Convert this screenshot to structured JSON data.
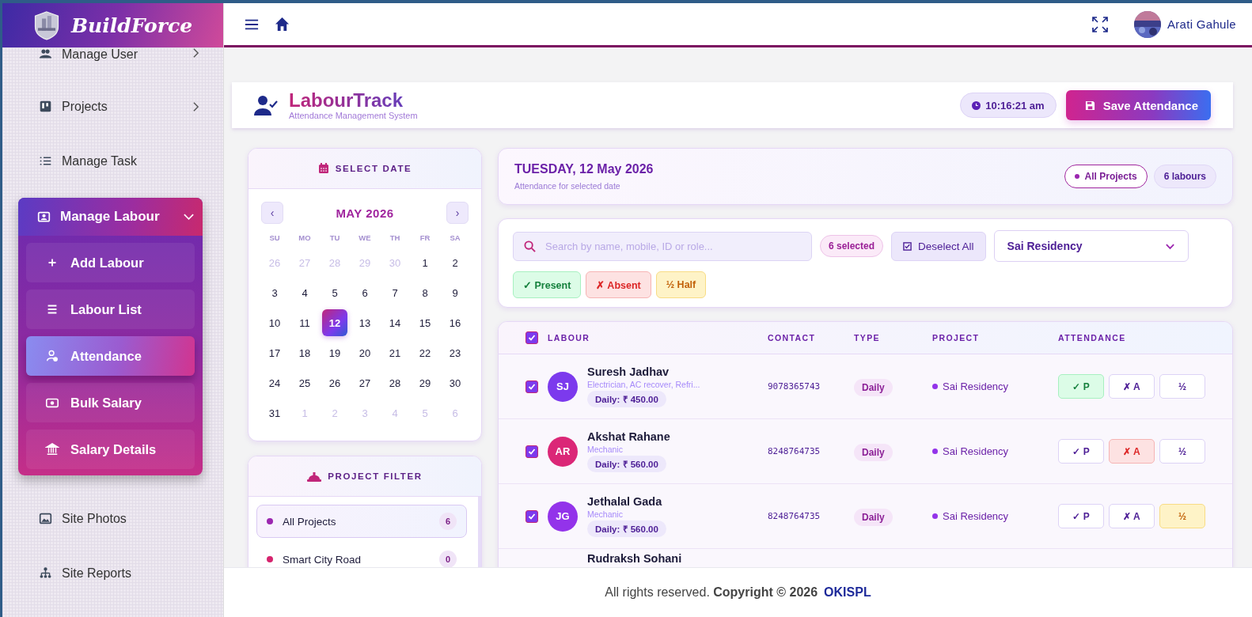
{
  "brand": "BuildForce",
  "sidebar": {
    "items": [
      {
        "label": "Manage User",
        "expanded": false
      },
      {
        "label": "Projects",
        "expanded": false
      },
      {
        "label": "Manage Task"
      },
      {
        "label": "Manage Labour",
        "expanded": true,
        "children": [
          {
            "label": "Add Labour",
            "selected": false
          },
          {
            "label": "Labour List",
            "selected": false
          },
          {
            "label": "Attendance",
            "selected": true
          },
          {
            "label": "Bulk Salary",
            "selected": false
          },
          {
            "label": "Salary Details",
            "selected": false
          }
        ]
      },
      {
        "label": "Site Photos"
      },
      {
        "label": "Site Reports"
      }
    ]
  },
  "topbar": {
    "user": "Arati Gahule"
  },
  "header": {
    "title": "LabourTrack",
    "subtitle": "Attendance Management System",
    "time": "10:16:21 am",
    "save_button": "Save Attendance"
  },
  "calendar": {
    "heading": "SELECT DATE",
    "prev": "‹",
    "next": "›",
    "month": "MAY 2026",
    "weekdays": [
      "SU",
      "MO",
      "TU",
      "WE",
      "TH",
      "FR",
      "SA"
    ],
    "days": [
      {
        "label": "26",
        "muted": true,
        "selected": false
      },
      {
        "label": "27",
        "muted": true,
        "selected": false
      },
      {
        "label": "28",
        "muted": true,
        "selected": false
      },
      {
        "label": "29",
        "muted": true,
        "selected": false
      },
      {
        "label": "30",
        "muted": true,
        "selected": false
      },
      {
        "label": "1",
        "muted": false,
        "selected": false
      },
      {
        "label": "2",
        "muted": false,
        "selected": false
      },
      {
        "label": "3",
        "muted": false,
        "selected": false
      },
      {
        "label": "4",
        "muted": false,
        "selected": false
      },
      {
        "label": "5",
        "muted": false,
        "selected": false
      },
      {
        "label": "6",
        "muted": false,
        "selected": false
      },
      {
        "label": "7",
        "muted": false,
        "selected": false
      },
      {
        "label": "8",
        "muted": false,
        "selected": false
      },
      {
        "label": "9",
        "muted": false,
        "selected": false
      },
      {
        "label": "10",
        "muted": false,
        "selected": false
      },
      {
        "label": "11",
        "muted": false,
        "selected": false
      },
      {
        "label": "12",
        "muted": false,
        "selected": true
      },
      {
        "label": "13",
        "muted": false,
        "selected": false
      },
      {
        "label": "14",
        "muted": false,
        "selected": false
      },
      {
        "label": "15",
        "muted": false,
        "selected": false
      },
      {
        "label": "16",
        "muted": false,
        "selected": false
      },
      {
        "label": "17",
        "muted": false,
        "selected": false
      },
      {
        "label": "18",
        "muted": false,
        "selected": false
      },
      {
        "label": "19",
        "muted": false,
        "selected": false
      },
      {
        "label": "20",
        "muted": false,
        "selected": false
      },
      {
        "label": "21",
        "muted": false,
        "selected": false
      },
      {
        "label": "22",
        "muted": false,
        "selected": false
      },
      {
        "label": "23",
        "muted": false,
        "selected": false
      },
      {
        "label": "24",
        "muted": false,
        "selected": false
      },
      {
        "label": "25",
        "muted": false,
        "selected": false
      },
      {
        "label": "26",
        "muted": false,
        "selected": false
      },
      {
        "label": "27",
        "muted": false,
        "selected": false
      },
      {
        "label": "28",
        "muted": false,
        "selected": false
      },
      {
        "label": "29",
        "muted": false,
        "selected": false
      },
      {
        "label": "30",
        "muted": false,
        "selected": false
      },
      {
        "label": "31",
        "muted": false,
        "selected": false
      },
      {
        "label": "1",
        "muted": true,
        "selected": false
      },
      {
        "label": "2",
        "muted": true,
        "selected": false
      },
      {
        "label": "3",
        "muted": true,
        "selected": false
      },
      {
        "label": "4",
        "muted": true,
        "selected": false
      },
      {
        "label": "5",
        "muted": true,
        "selected": false
      },
      {
        "label": "6",
        "muted": true,
        "selected": false
      }
    ]
  },
  "project_filter": {
    "heading": "PROJECT FILTER",
    "items": [
      {
        "label": "All Projects",
        "count": "6",
        "color": "#9c27b0",
        "selected": true
      },
      {
        "label": "Smart City Road",
        "count": "0",
        "color": "#d6246e",
        "selected": false
      }
    ]
  },
  "date_card": {
    "date": "TUESDAY, 12 May 2026",
    "caption": "Attendance for selected date",
    "project_chip": "All Projects",
    "count_chip": "6 labours"
  },
  "filters": {
    "search_placeholder": "Search by name, mobile, ID or role...",
    "selected_count": "6 selected",
    "deselect": "Deselect All",
    "project": "Sai Residency",
    "bulk": [
      {
        "label": "✓ Present",
        "kind": "present"
      },
      {
        "label": "✗ Absent",
        "kind": "absent"
      },
      {
        "label": "½ Half",
        "kind": "half"
      }
    ]
  },
  "table": {
    "all_checked": true,
    "columns": [
      "LABOUR",
      "CONTACT",
      "TYPE",
      "PROJECT",
      "ATTENDANCE"
    ],
    "rows": [
      {
        "checked": true,
        "initials": "SJ",
        "color": "#7c3aed",
        "name": "Suresh Jadhav",
        "role": "Electrician, AC recover, Refri...",
        "wage": "Daily: ₹ 450.00",
        "contact": "9078365743",
        "type": "Daily",
        "project": "Sai Residency",
        "attendance": [
          {
            "label": "✓ P",
            "selected": true
          },
          {
            "label": "✗ A",
            "selected": false
          },
          {
            "label": "½",
            "selected": false
          }
        ]
      },
      {
        "checked": true,
        "initials": "AR",
        "color": "#db2777",
        "name": "Akshat Rahane",
        "role": "Mechanic",
        "wage": "Daily: ₹ 560.00",
        "contact": "8248764735",
        "type": "Daily",
        "project": "Sai Residency",
        "attendance": [
          {
            "label": "✓ P",
            "selected": false
          },
          {
            "label": "✗ A",
            "selected": true
          },
          {
            "label": "½",
            "selected": false
          }
        ]
      },
      {
        "checked": true,
        "initials": "JG",
        "color": "#9333ea",
        "name": "Jethalal Gada",
        "role": "Mechanic",
        "wage": "Daily: ₹ 560.00",
        "contact": "8248764735",
        "type": "Daily",
        "project": "Sai Residency",
        "attendance": [
          {
            "label": "✓ P",
            "selected": false
          },
          {
            "label": "✗ A",
            "selected": false
          },
          {
            "label": "½",
            "selected": true
          }
        ]
      },
      {
        "name": "Rudraksh Sohani"
      }
    ]
  },
  "footer": {
    "text": "All rights reserved. **Copyright © 2026**",
    "link": "OKISPL"
  }
}
